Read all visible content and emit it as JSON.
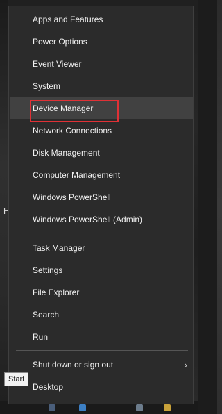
{
  "menu": {
    "group1": [
      {
        "label": "Apps and Features"
      },
      {
        "label": "Power Options"
      },
      {
        "label": "Event Viewer"
      },
      {
        "label": "System"
      },
      {
        "label": "Device Manager",
        "highlighted": true
      },
      {
        "label": "Network Connections"
      },
      {
        "label": "Disk Management"
      },
      {
        "label": "Computer Management"
      },
      {
        "label": "Windows PowerShell"
      },
      {
        "label": "Windows PowerShell (Admin)"
      }
    ],
    "group2": [
      {
        "label": "Task Manager"
      },
      {
        "label": "Settings"
      },
      {
        "label": "File Explorer"
      },
      {
        "label": "Search"
      },
      {
        "label": "Run"
      }
    ],
    "group3": [
      {
        "label": "Shut down or sign out",
        "submenu": true
      },
      {
        "label": "Desktop"
      }
    ]
  },
  "tooltip": {
    "label": "Start"
  },
  "background": {
    "stray_text": "H"
  },
  "colors": {
    "menu_bg": "#2b2b2b",
    "hover_bg": "#414141",
    "highlight_border": "#e03136",
    "text": "#f2f2f2"
  },
  "icons": {
    "submenu": "chevron-right-icon"
  }
}
